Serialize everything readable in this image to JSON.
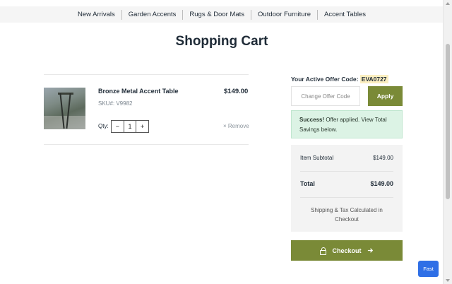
{
  "nav": {
    "items": [
      {
        "label": "New Arrivals"
      },
      {
        "label": "Garden Accents"
      },
      {
        "label": "Rugs & Door Mats"
      },
      {
        "label": "Outdoor Furniture"
      },
      {
        "label": "Accent Tables"
      }
    ]
  },
  "page": {
    "title": "Shopping Cart"
  },
  "cart": {
    "item": {
      "name": "Bronze Metal Accent Table",
      "price": "$149.00",
      "sku": "SKU#: V9982",
      "qty_label": "Qty:",
      "qty_minus": "−",
      "qty_value": "1",
      "qty_plus": "+",
      "remove_label": "× Remove",
      "image_alt_icon": "product-photo"
    }
  },
  "offer": {
    "label": "Your Active Offer Code:",
    "code": "EVA0727",
    "input_placeholder": "Change Offer Code",
    "apply_label": "Apply",
    "success_strong": "Success!",
    "success_text": " Offer applied. View Total Savings below."
  },
  "summary": {
    "subtotal_label": "Item Subtotal",
    "subtotal_value": "$149.00",
    "total_label": "Total",
    "total_value": "$149.00",
    "note": "Shipping & Tax Calculated in Checkout"
  },
  "checkout": {
    "label": "Checkout",
    "icon": "lock-icon",
    "arrow_icon": "arrow-right-icon"
  },
  "fast": {
    "label": "Fast"
  },
  "colors": {
    "accent": "#7a8a37",
    "success_bg": "#dcf3e5",
    "code_highlight": "#fbeec0",
    "fast_blue": "#2f6fe6"
  }
}
